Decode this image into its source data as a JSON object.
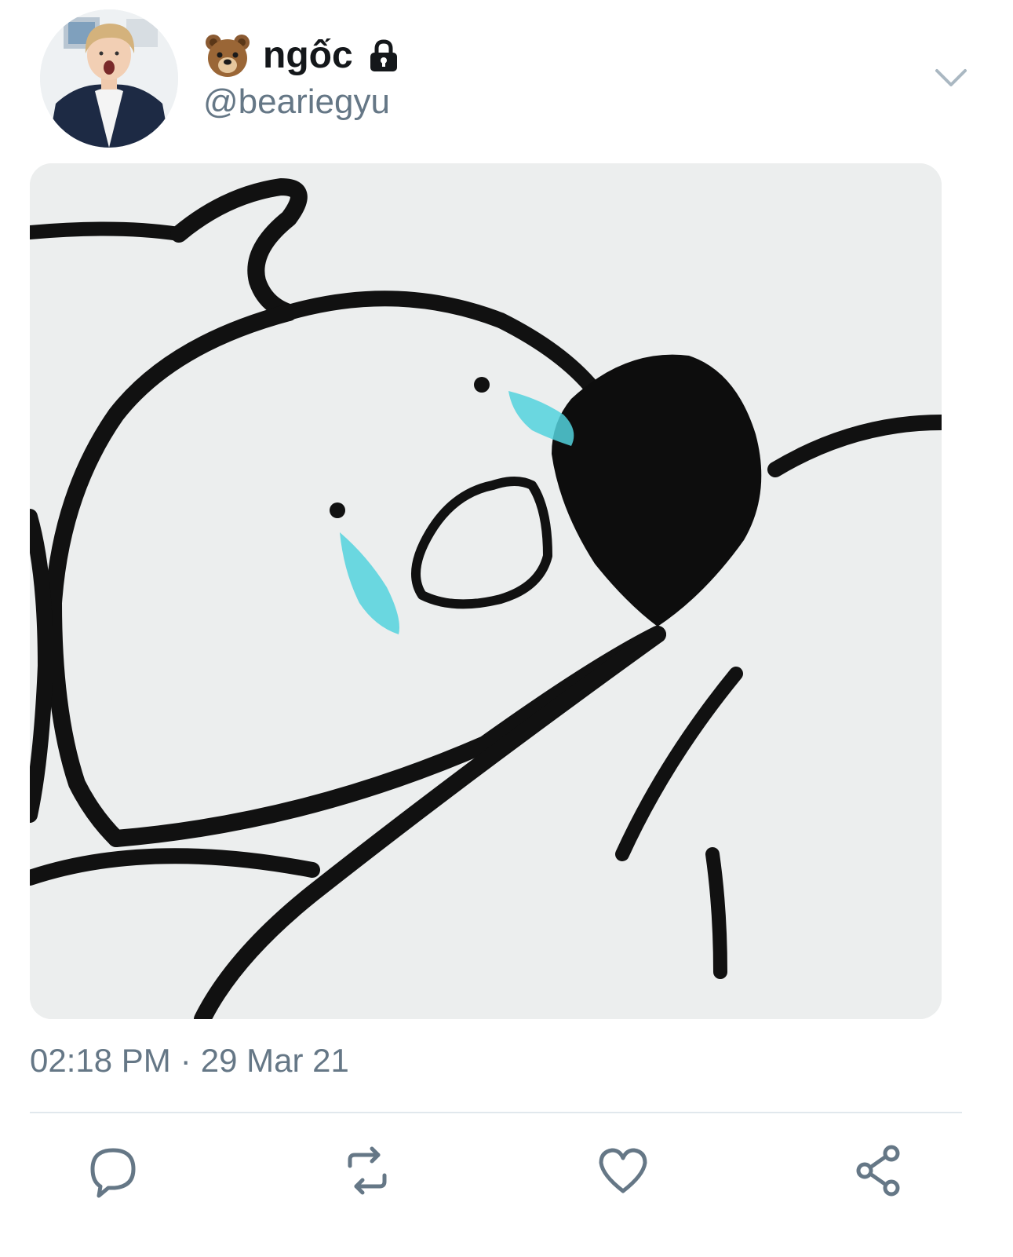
{
  "tweet": {
    "author": {
      "display_name": "ngốc",
      "handle": "@beariegyu",
      "protected": true,
      "name_prefix_emoji": "bear-face-emoji",
      "avatar": "profile-photo"
    },
    "media": {
      "type": "image",
      "description_icon": "crying-cartoon-sticker"
    },
    "timestamp": {
      "time": "02:18 PM",
      "separator": "·",
      "date": "29 Mar 21"
    },
    "actions": [
      {
        "name": "reply",
        "icon": "reply-icon"
      },
      {
        "name": "retweet",
        "icon": "retweet-icon"
      },
      {
        "name": "like",
        "icon": "heart-icon"
      },
      {
        "name": "share",
        "icon": "share-icon"
      }
    ]
  },
  "colors": {
    "primary_text": "#14171a",
    "secondary_text": "#657786",
    "icon": "#657786",
    "divider": "#e1e8ed",
    "tear_blue": "#54d2dd"
  }
}
